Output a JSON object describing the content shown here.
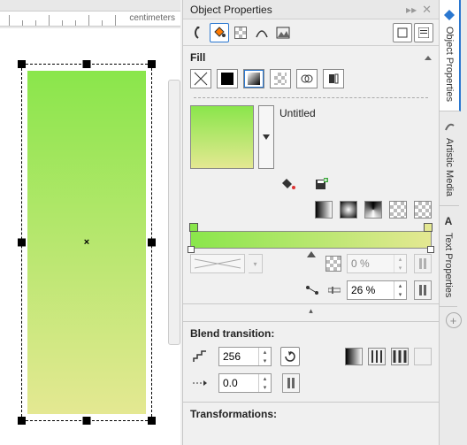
{
  "ruler": {
    "unit_label": "centimeters"
  },
  "panel": {
    "title": "Object Properties",
    "fill_header": "Fill",
    "preset_name": "Untitled",
    "opacity": "0 %",
    "node_pos": "26 %",
    "blend": {
      "header": "Blend transition:",
      "steps": "256",
      "rotation": "0.0"
    },
    "transformations_header": "Transformations:"
  },
  "side_tabs": {
    "t1": "Object Properties",
    "t2": "Artistic Media",
    "t3": "Text Properties"
  }
}
